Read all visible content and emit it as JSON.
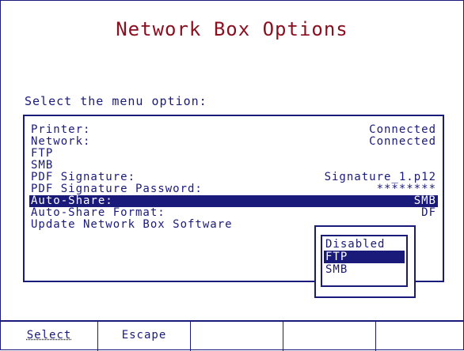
{
  "title": "Network Box Options",
  "prompt": "Select the menu option:",
  "menu": {
    "items": [
      {
        "label": "Printer:",
        "value": "Connected"
      },
      {
        "label": "Network:",
        "value": "Connected"
      },
      {
        "label": "FTP",
        "value": ""
      },
      {
        "label": "SMB",
        "value": ""
      },
      {
        "label": "PDF Signature:",
        "value": "Signature_1.p12"
      },
      {
        "label": "PDF Signature Password:",
        "value": "********"
      },
      {
        "label": "Auto-Share:",
        "value": "SMB"
      },
      {
        "label": "Auto-Share Format:",
        "value": "DF"
      },
      {
        "label": "Update Network Box Software",
        "value": ""
      }
    ],
    "selected_index": 6
  },
  "dropdown": {
    "options": [
      "Disabled",
      "FTP",
      "SMB"
    ],
    "selected_index": 1
  },
  "softkeys": [
    "Select",
    "Escape",
    "",
    "",
    ""
  ],
  "colors": {
    "accent": "#1a1a7a",
    "title": "#8a1020"
  }
}
